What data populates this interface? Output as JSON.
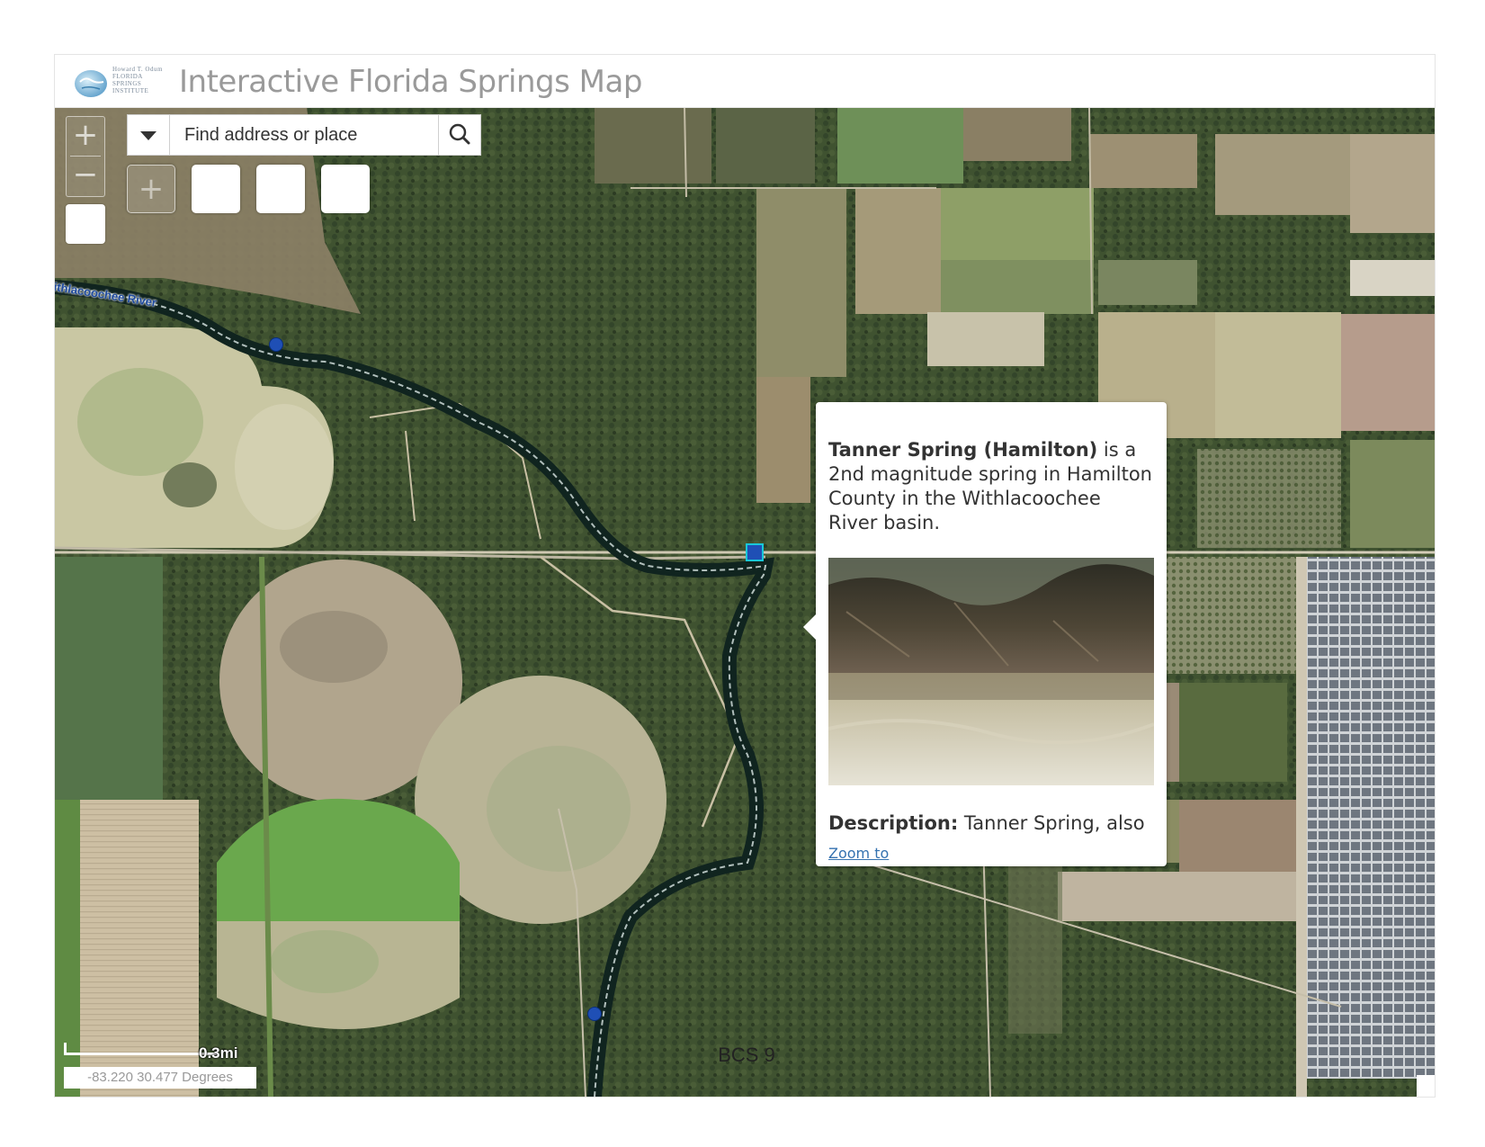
{
  "header": {
    "title": "Interactive Florida Springs Map",
    "logo_text": [
      "Howard T. Odum",
      "FLORIDA",
      "SPRINGS",
      "INSTITUTE"
    ]
  },
  "map_controls": {
    "zoom_in": "+",
    "zoom_out": "−",
    "search_placeholder": "Find address or place",
    "add_tool": "+"
  },
  "map": {
    "river_label": "ithlacoochee River",
    "popup": {
      "spring_name": "Tanner Spring (Hamilton)",
      "intro_rest": " is a 2nd magnitude spring in Hamilton County in the Withlacoochee River basin.",
      "description_label": "Description:",
      "description_text": " Tanner Spring, also",
      "zoom_link": "Zoom to"
    },
    "scale_label": "0.3mi",
    "coordinates": "-83.220 30.477 Degrees"
  },
  "footer": {
    "page_label": "BCS 9"
  },
  "colors": {
    "spring_marker": "#1f4fb5",
    "selected_marker": "#19c7d8",
    "river": "#10241f",
    "title_gray": "#9a9a9a",
    "link_blue": "#3572b0"
  }
}
